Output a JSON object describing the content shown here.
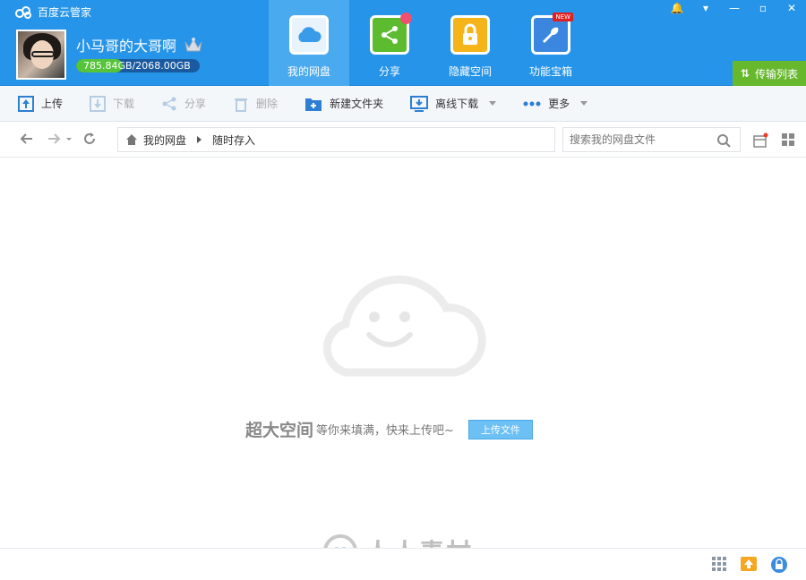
{
  "app": {
    "title": "百度云管家"
  },
  "user": {
    "name": "小马哥的大哥啊",
    "quota_used": "785.84",
    "quota_rest": "GB/2068.00GB",
    "quota_fraction": 0.38
  },
  "nav": [
    {
      "label": "我的网盘",
      "icon": "cloud-drive-icon"
    },
    {
      "label": "分享",
      "icon": "share-icon"
    },
    {
      "label": "隐藏空间",
      "icon": "lock-icon"
    },
    {
      "label": "功能宝箱",
      "icon": "wrench-icon",
      "badge": "NEW"
    }
  ],
  "transfer": {
    "label": "传输列表"
  },
  "toolbar": {
    "upload": "上传",
    "download": "下载",
    "share": "分享",
    "delete": "删除",
    "new_folder": "新建文件夹",
    "offline_download": "离线下载",
    "more": "更多"
  },
  "breadcrumb": {
    "root": "我的网盘",
    "current": "随时存入"
  },
  "search": {
    "placeholder": "搜索我的网盘文件"
  },
  "empty": {
    "big": "超大空间",
    "small": "等你来填满，快来上传吧~",
    "button": "上传文件"
  },
  "watermark": {
    "text": "人人素材"
  },
  "colors": {
    "header": "#2694e8",
    "active_nav": "#4aaaf0",
    "transfer": "#68b82e",
    "quota_fill": "#56c43a"
  }
}
